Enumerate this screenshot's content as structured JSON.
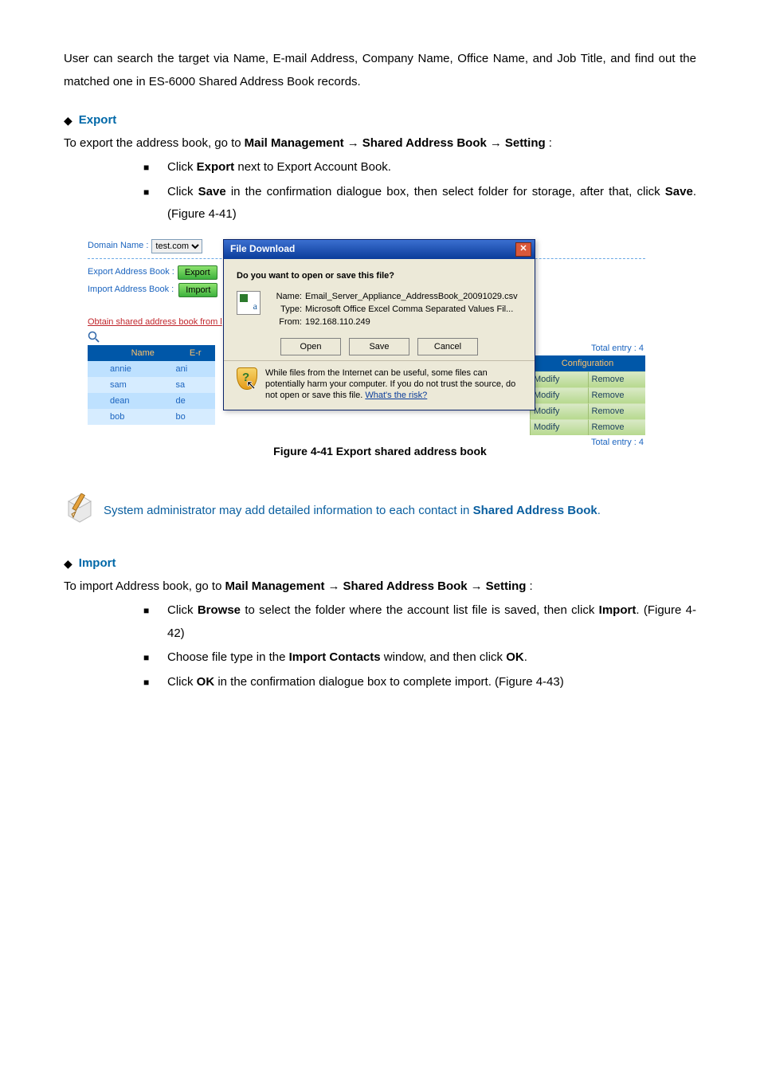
{
  "intro": "User can search the target via Name, E-mail Address, Company Name, Office Name, and Job Title, and find out the matched one in ES-6000 Shared Address Book records.",
  "sectionA": {
    "title": "Export",
    "lead": "To export the address book, go to ",
    "navA": "Mail Management",
    "navB": "Shared Address Book",
    "navC": "Setting",
    "bullets": [
      {
        "pre": "Click ",
        "bold": "Export",
        "post": " next to Export Account Book."
      },
      {
        "pre": "Click ",
        "bold": "Save",
        "post": " in the confirmation dialogue box, then select folder for storage, after that, click ",
        "bold2": "Save",
        "tail": ". (Figure 4-41)"
      }
    ]
  },
  "screenshot": {
    "domainLabel": "Domain Name :",
    "domainValue": "test.com",
    "exportLabel": "Export Address Book :",
    "exportBtn": "Export",
    "importLabel": "Import Address Book :",
    "importBtn": "Import",
    "obtainLink": "Obtain shared address book from l",
    "totalEntry": "Total entry : 4",
    "configHeader": "Configuration",
    "modify": "Modify",
    "remove": "Remove",
    "tableHeaders": {
      "name": "Name",
      "email": "E-r"
    },
    "rows": [
      {
        "name": "annie",
        "email": "ani"
      },
      {
        "name": "sam",
        "email": "sa"
      },
      {
        "name": "dean",
        "email": "de"
      },
      {
        "name": "bob",
        "email": "bo"
      }
    ],
    "dialog": {
      "title": "File Download",
      "question": "Do you want to open or save this file?",
      "nameLabel": "Name:",
      "nameValue": "Email_Server_Appliance_AddressBook_20091029.csv",
      "typeLabel": "Type:",
      "typeValue": "Microsoft Office Excel Comma Separated Values Fil...",
      "fromLabel": "From:",
      "fromValue": "192.168.110.249",
      "open": "Open",
      "save": "Save",
      "cancel": "Cancel",
      "warn": "While files from the Internet can be useful, some files can potentially harm your computer. If you do not trust the source, do not open or save this file. ",
      "risk": "What's the risk?"
    }
  },
  "figCaptionA": "Figure 4-41 Export shared address book",
  "note": {
    "pre": "System administrator may add detailed information to each contact in ",
    "bold": "Shared Address Book",
    "post": "."
  },
  "sectionB": {
    "title": "Import",
    "lead": "To import Address book, go to ",
    "navA": "Mail Management",
    "navB": "Shared Address Book",
    "navC": "Setting",
    "bullets": [
      {
        "pre": "Click ",
        "bold": "Browse",
        "post": " to select the folder where the account list file is saved, then click ",
        "bold2": "Import",
        "tail": ". (Figure 4-42)"
      },
      {
        "pre": "Choose file type in the ",
        "bold": "Import Contacts",
        "post": " window, and then click ",
        "bold2": "OK",
        "tail": "."
      },
      {
        "pre": "Click ",
        "bold": "OK",
        "post": " in the confirmation dialogue box to complete import. (Figure 4-43)"
      }
    ]
  }
}
